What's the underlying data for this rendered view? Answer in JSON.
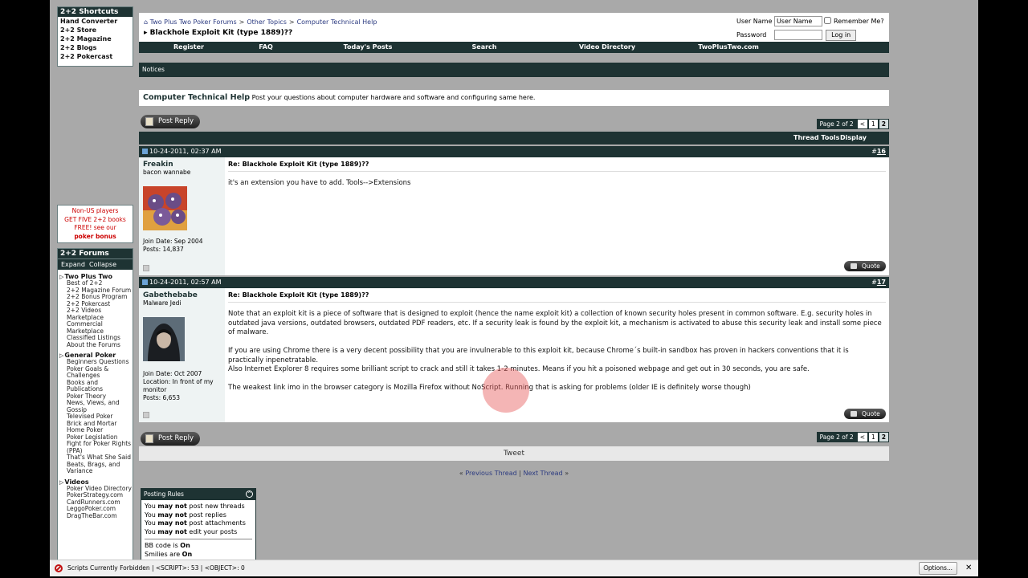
{
  "sidebar": {
    "shortcuts_title": "2+2 Shortcuts",
    "shortcuts": [
      "Hand Converter",
      "2+2 Store",
      "2+2 Magazine",
      "2+2 Blogs",
      "2+2 Pokercast"
    ],
    "promo": {
      "l1": "Non-US players",
      "l2": "GET FIVE 2+2 books",
      "l3": "FREE! see our",
      "l4": "poker bonus"
    },
    "forums_title": "2+2 Forums",
    "expand": "Expand",
    "collapse": "Collapse",
    "groups": [
      {
        "title": "Two Plus Two",
        "items": [
          "Best of 2+2",
          "2+2 Magazine Forum",
          "2+2 Bonus Program",
          "2+2 Pokercast",
          "2+2 Videos",
          "Marketplace",
          "Commercial Marketplace",
          "Classified Listings",
          "About the Forums"
        ]
      },
      {
        "title": "General Poker",
        "items": [
          "Beginners Questions",
          "Poker Goals & Challenges",
          "Books and Publications",
          "Poker Theory",
          "News, Views, and Gossip",
          "Televised Poker",
          "Brick and Mortar",
          "Home Poker",
          "Poker Legislation",
          "Fight for Poker Rights (PPA)",
          "That's What She Said",
          "Beats, Brags, and Variance"
        ]
      },
      {
        "title": "Videos",
        "items": [
          "Poker Video Directory",
          "PokerStrategy.com",
          "CardRunners.com",
          "LeggoPoker.com",
          "DragTheBar.com"
        ]
      }
    ]
  },
  "header": {
    "breadcrumb": [
      "Two Plus Two Poker Forums",
      "Other Topics",
      "Computer Technical Help"
    ],
    "thread_title": "Blackhole Exploit Kit (type 1889)??",
    "login": {
      "user_label": "User Name",
      "user_value": "User Name",
      "remember": "Remember Me?",
      "password_label": "Password",
      "login_button": "Log in"
    }
  },
  "nav": [
    "Register",
    "FAQ",
    "Today's Posts",
    "Search",
    "Video Directory",
    "TwoPlusTwo.com"
  ],
  "notices": "Notices",
  "forum": {
    "name": "Computer Technical Help",
    "desc": "Post your questions about computer hardware and software and configuring same here."
  },
  "post_reply": "Post Reply",
  "pager": {
    "label": "Page 2 of 2",
    "prev": "<",
    "p1": "1",
    "p2": "2"
  },
  "thread_tools": "Thread Tools",
  "display_modes": "Display Modes",
  "posts": [
    {
      "date": "10-24-2011, 02:37 AM",
      "num_prefix": "#",
      "num": "16",
      "user": "Freakin",
      "user_title": "bacon wannabe",
      "join": "Join Date: Sep 2004",
      "posts": "Posts: 14,837",
      "title": "Re: Blackhole Exploit Kit (type 1889)??",
      "text": "it's an extension you have to add. Tools-->Extensions"
    },
    {
      "date": "10-24-2011, 02:57 AM",
      "num_prefix": "#",
      "num": "17",
      "user": "Gabethebabe",
      "user_title": "Malware Jedi",
      "join": "Join Date: Oct 2007",
      "location": "Location: In front of my monitor",
      "posts": "Posts: 6,653",
      "title": "Re: Blackhole Exploit Kit (type 1889)??",
      "p1": "Note that an exploit kit is a piece of software that is designed to exploit (hence the name exploit kit) a collection of known security holes present in common software. E.g. security holes in outdated java versions, outdated browsers, outdated PDF readers, etc. If a security leak is found by the exploit kit, a mechanism is activated to abuse this security leak and install some piece of malware.",
      "p2": "If you are using Chrome there is a very decent possibility that you are invulnerable to this exploit kit, because Chrome´s built-in sandbox has proven in hackers conventions that it is practically inpenetratable.",
      "p3": "Also Internet Explorer 8 requires some brilliant script to crack and still it takes 1-2 minutes. Means if you hit a poisoned webpage and get out in 30 seconds, you are safe.",
      "p4": "The weakest link imo in the browser category is Mozilla Firefox without NoScript. Running that is asking for problems (older IE is definitely worse though)"
    }
  ],
  "quote": "Quote",
  "tweet": "Tweet",
  "threadnav": {
    "prev": "Previous Thread",
    "sep": "|",
    "next": "Next Thread",
    "lq": "«",
    "rq": "»"
  },
  "rules": {
    "title": "Posting Rules",
    "lines": [
      {
        "pre": "You ",
        "b": "may not",
        "post": " post new threads"
      },
      {
        "pre": "You ",
        "b": "may not",
        "post": " post replies"
      },
      {
        "pre": "You ",
        "b": "may not",
        "post": " post attachments"
      },
      {
        "pre": "You ",
        "b": "may not",
        "post": " edit your posts"
      }
    ],
    "bbcode": "BB code is ",
    "bbcode_v": "On",
    "smilies": "Smilies are ",
    "smilies_v": "On"
  },
  "statusbar": {
    "message": "Scripts Currently Forbidden | <SCRIPT>: 53 | <OBJECT>: 0",
    "options": "Options...",
    "close": "✕"
  },
  "colors": {
    "header_dark": "#1e3333",
    "background": "#a9a9a9",
    "noscript_red": "#c21212"
  }
}
